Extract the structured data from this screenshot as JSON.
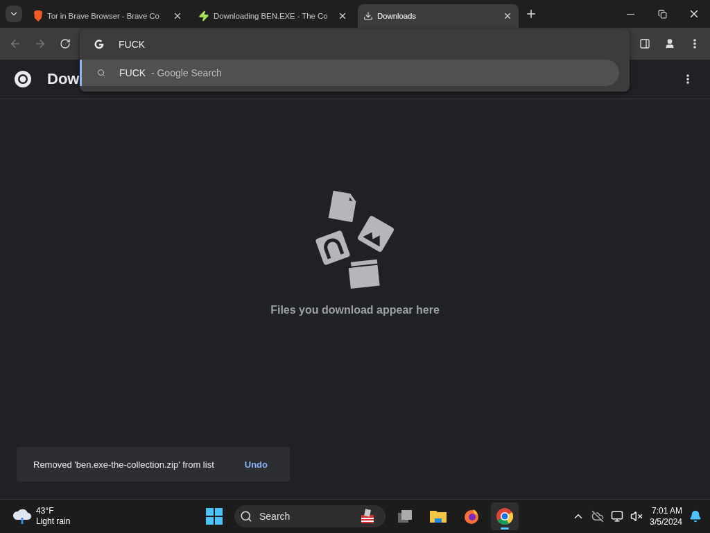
{
  "tabs": [
    {
      "kind": "shield",
      "title": "Tor in Brave Browser - Brave Co",
      "selected": false
    },
    {
      "kind": "bolt",
      "title": "Downloading BEN.EXE - The Co",
      "selected": false
    },
    {
      "kind": "download",
      "title": "Downloads",
      "selected": true
    }
  ],
  "omnibox": {
    "value": "FUCK",
    "suggestions": [
      {
        "query": "FUCK",
        "source": "- Google Search",
        "selected": true
      }
    ]
  },
  "page": {
    "title": "Dow",
    "empty_message": "Files you download appear here"
  },
  "toast": {
    "message": "Removed 'ben.exe-the-collection.zip' from list",
    "action": "Undo"
  },
  "taskbar": {
    "weather": {
      "temperature": "43°F",
      "condition": "Light rain"
    },
    "search": {
      "placeholder": "Search"
    },
    "apps": [
      {
        "kind": "windows",
        "selected": false
      },
      {
        "kind": "folder",
        "selected": false
      },
      {
        "kind": "firefox",
        "selected": false
      },
      {
        "kind": "chrome",
        "selected": true
      }
    ],
    "clock": {
      "time": "7:01 AM",
      "date": "3/5/2024"
    }
  }
}
